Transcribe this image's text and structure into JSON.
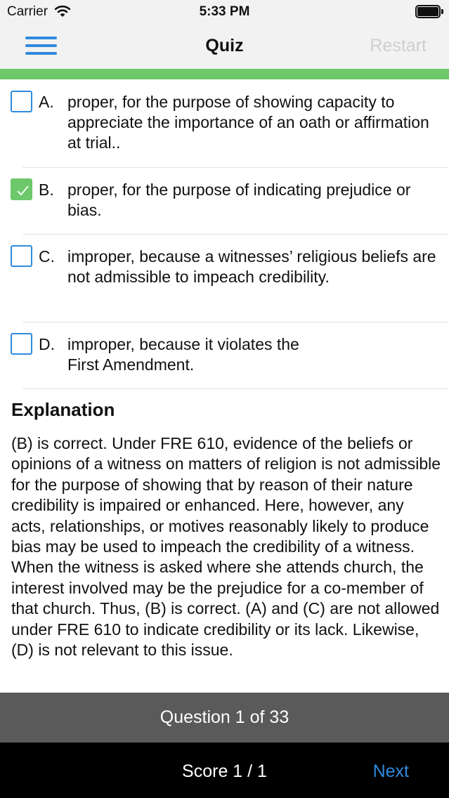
{
  "status_bar": {
    "carrier": "Carrier",
    "time": "5:33 PM",
    "icons": [
      "wifi-icon",
      "battery-icon"
    ]
  },
  "nav": {
    "title": "Quiz",
    "restart_label": "Restart",
    "menu_icon": "hamburger-menu-icon",
    "accent_color": "#2f8bdc",
    "disabled_color": "#cfcfcf"
  },
  "progress": {
    "fraction": 1.0,
    "color": "#6cc86a"
  },
  "options": [
    {
      "letter": "A.",
      "text": "proper, for the purpose of showing capacity to appreciate the importance of an oath or affirmation at trial..",
      "checked": false
    },
    {
      "letter": "B.",
      "text": "proper, for the purpose of indicating prejudice or bias.",
      "checked": true
    },
    {
      "letter": "C.",
      "text": "improper, because a witnesses’ religious beliefs are not admissible to impeach credibility.",
      "checked": false
    },
    {
      "letter": "D.",
      "text": "improper, because it violates the First Amendment.",
      "checked": false
    }
  ],
  "explanation": {
    "title": "Explanation",
    "body": "(B) is correct. Under FRE 610, evidence of the beliefs or opinions of a witness on matters of religion is not admissible for the purpose of showing that by reason of their nature credibility is impaired or enhanced. Here, however, any acts, relationships, or motives reasonably likely to produce bias may be used to impeach the credibility of a witness. When the witness is asked where she attends church, the interest involved may be the prejudice for a co-member of that church. Thus, (B) is correct. (A) and (C) are not allowed under FRE 610 to indicate credibility or its lack. Likewise, (D) is not relevant to this issue."
  },
  "footer": {
    "question_count": "Question 1 of 33",
    "score": "Score 1 / 1",
    "next_label": "Next"
  }
}
